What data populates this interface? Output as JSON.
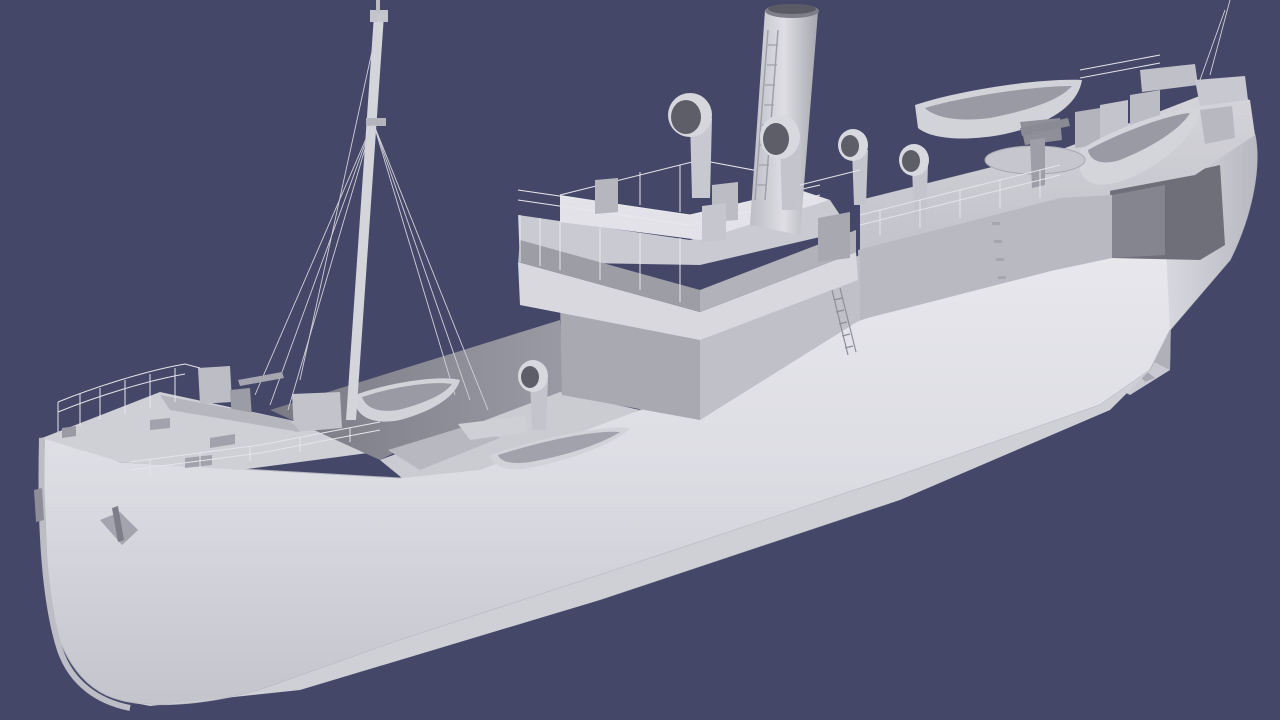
{
  "scene": {
    "subject": "",
    "background_color": "#454769",
    "model_color_light": "#e6e6ec",
    "model_color_mid": "#c8c8d0",
    "model_color_dark": "#8e8e98",
    "model_color_shadow": "#6e6e78"
  }
}
